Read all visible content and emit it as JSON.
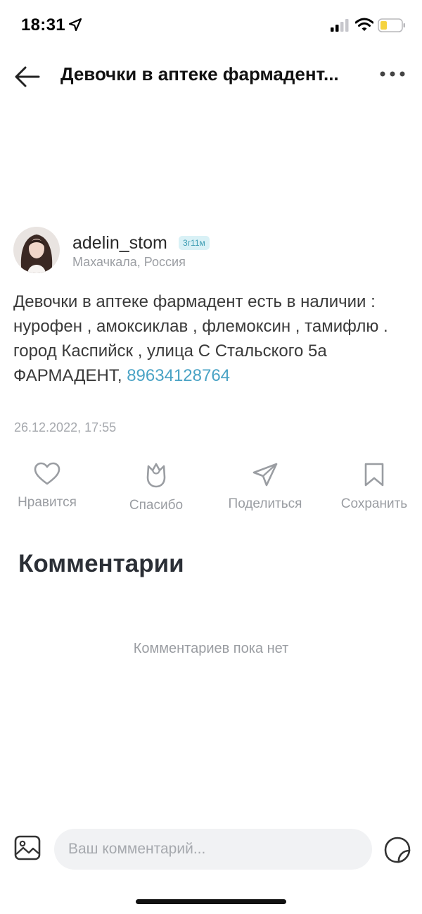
{
  "status_bar": {
    "time": "18:31",
    "icons": [
      "location-arrow-icon",
      "signal-icon",
      "wifi-icon",
      "battery-icon"
    ],
    "battery_color": "#f5d33f"
  },
  "header": {
    "title": "Девочки в аптеке фармадент...",
    "back_icon": "back-arrow-icon",
    "more_icon": "more-icon"
  },
  "post": {
    "author": {
      "username": "adelin_stom",
      "badge": "3г11м",
      "location": "Махачкала, Россия"
    },
    "text": "Девочки в аптеке фармадент есть в наличии : нурофен , амоксиклав , флемоксин , тамифлю . город Каспийск , улица С Стальского 5а ФАРМАДЕНТ,",
    "phone": "89634128764",
    "date": "26.12.2022, 17:55"
  },
  "actions": [
    {
      "label": "Нравится",
      "icon": "heart-icon"
    },
    {
      "label": "Спасибо",
      "icon": "tulip-icon"
    },
    {
      "label": "Поделиться",
      "icon": "send-icon"
    },
    {
      "label": "Сохранить",
      "icon": "bookmark-icon"
    }
  ],
  "comments": {
    "title": "Комментарии",
    "empty_text": "Комментариев пока нет"
  },
  "composer": {
    "placeholder": "Ваш комментарий...",
    "image_icon": "image-icon",
    "sticker_icon": "sticker-icon"
  },
  "colors": {
    "accent": "#4aa3c5",
    "muted_text": "#9a9da2",
    "badge_bg": "#d9f1f6",
    "input_bg": "#f1f2f4"
  }
}
